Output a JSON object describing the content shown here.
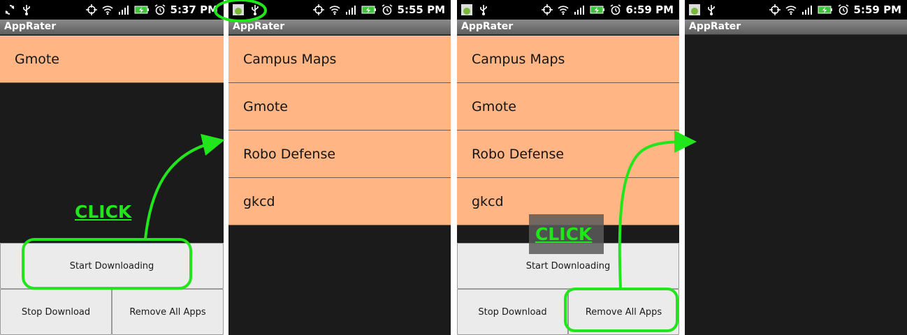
{
  "app_title": "AppRater",
  "colors": {
    "list_item_bg": "#ffb684",
    "annotation_green": "#22e61c",
    "screen_bg": "#1b1b1b"
  },
  "screens": [
    {
      "status": {
        "left_icons": [
          "sync-icon",
          "usb-icon"
        ],
        "time": "5:37 PM"
      },
      "items": [
        "Gmote"
      ],
      "buttons": {
        "start": "Start Downloading",
        "stop": "Stop Download",
        "remove": "Remove All Apps"
      },
      "annotation": "CLICK"
    },
    {
      "status": {
        "left_icons": [
          "android-notification-icon",
          "usb-icon"
        ],
        "time": "5:55 PM"
      },
      "items": [
        "Campus Maps",
        "Gmote",
        "Robo Defense",
        "gkcd"
      ]
    },
    {
      "status": {
        "left_icons": [
          "android-notification-icon",
          "usb-icon"
        ],
        "time": "6:59 PM"
      },
      "items": [
        "Campus Maps",
        "Gmote",
        "Robo Defense",
        "gkcd"
      ],
      "buttons": {
        "start": "Start Downloading",
        "stop": "Stop Download",
        "remove": "Remove All Apps"
      },
      "annotation": "CLICK"
    },
    {
      "status": {
        "left_icons": [
          "android-notification-icon",
          "usb-icon"
        ],
        "time": "5:59 PM"
      },
      "items": []
    }
  ]
}
